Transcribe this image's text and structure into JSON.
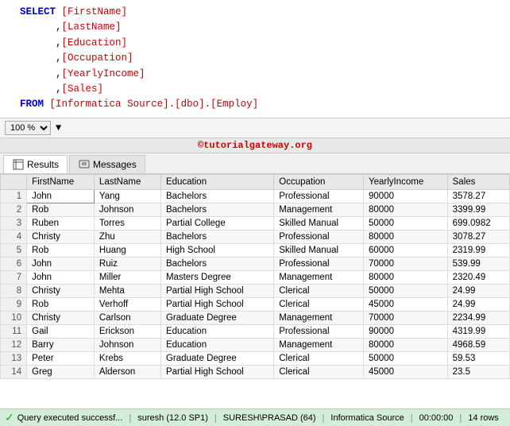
{
  "editor": {
    "lines": [
      {
        "indent": "  ",
        "keyword": "SELECT",
        "content": " [FirstName]"
      },
      {
        "indent": "        ,",
        "keyword": "",
        "content": "[LastName]"
      },
      {
        "indent": "        ,",
        "keyword": "",
        "content": "[Education]"
      },
      {
        "indent": "        ,",
        "keyword": "",
        "content": "[Occupation]"
      },
      {
        "indent": "        ,",
        "keyword": "",
        "content": "[YearlyIncome]"
      },
      {
        "indent": "        ,",
        "keyword": "",
        "content": "[Sales]"
      },
      {
        "indent": "  ",
        "keyword": "FROM",
        "content": " [Informatica Source].[dbo].[Employ]"
      }
    ]
  },
  "toolbar": {
    "zoom": "100 %"
  },
  "watermark": "©tutorialgateway.org",
  "tabs": [
    {
      "label": "Results",
      "active": true
    },
    {
      "label": "Messages",
      "active": false
    }
  ],
  "table": {
    "columns": [
      "",
      "FirstName",
      "LastName",
      "Education",
      "Occupation",
      "YearlyIncome",
      "Sales"
    ],
    "rows": [
      [
        "1",
        "John",
        "Yang",
        "Bachelors",
        "Professional",
        "90000",
        "3578.27"
      ],
      [
        "2",
        "Rob",
        "Johnson",
        "Bachelors",
        "Management",
        "80000",
        "3399.99"
      ],
      [
        "3",
        "Ruben",
        "Torres",
        "Partial College",
        "Skilled Manual",
        "50000",
        "699.0982"
      ],
      [
        "4",
        "Christy",
        "Zhu",
        "Bachelors",
        "Professional",
        "80000",
        "3078.27"
      ],
      [
        "5",
        "Rob",
        "Huang",
        "High School",
        "Skilled Manual",
        "60000",
        "2319.99"
      ],
      [
        "6",
        "John",
        "Ruiz",
        "Bachelors",
        "Professional",
        "70000",
        "539.99"
      ],
      [
        "7",
        "John",
        "Miller",
        "Masters Degree",
        "Management",
        "80000",
        "2320.49"
      ],
      [
        "8",
        "Christy",
        "Mehta",
        "Partial High School",
        "Clerical",
        "50000",
        "24.99"
      ],
      [
        "9",
        "Rob",
        "Verhoff",
        "Partial High School",
        "Clerical",
        "45000",
        "24.99"
      ],
      [
        "10",
        "Christy",
        "Carlson",
        "Graduate Degree",
        "Management",
        "70000",
        "2234.99"
      ],
      [
        "11",
        "Gail",
        "Erickson",
        "Education",
        "Professional",
        "90000",
        "4319.99"
      ],
      [
        "12",
        "Barry",
        "Johnson",
        "Education",
        "Management",
        "80000",
        "4968.59"
      ],
      [
        "13",
        "Peter",
        "Krebs",
        "Graduate Degree",
        "Clerical",
        "50000",
        "59.53"
      ],
      [
        "14",
        "Greg",
        "Alderson",
        "Partial High School",
        "Clerical",
        "45000",
        "23.5"
      ]
    ]
  },
  "statusbar": {
    "message": "Query executed successf...",
    "user": "suresh (12.0 SP1)",
    "server": "SURESH\\PRASAD (64)",
    "database": "Informatica Source",
    "time": "00:00:00",
    "rows": "14 rows"
  }
}
